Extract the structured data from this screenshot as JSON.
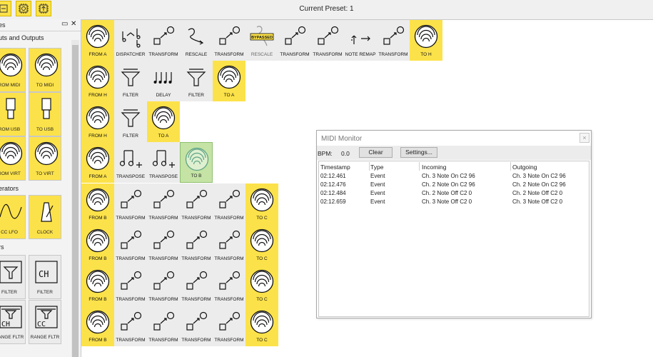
{
  "toolbar": {
    "current_preset": "Current Preset: 1"
  },
  "left_panel": {
    "title": "es",
    "sections": {
      "io": "uts and Outputs",
      "generators": "erators",
      "filters": "rs"
    },
    "items": [
      {
        "label": "ROM MIDI"
      },
      {
        "label": "TO MIDI"
      },
      {
        "label": "ROM USB"
      },
      {
        "label": "TO USB"
      },
      {
        "label": "ROM VIRT"
      },
      {
        "label": "TO VIRT"
      },
      {
        "label": "CC LFO"
      },
      {
        "label": "CLOCK"
      },
      {
        "label": "FILTER"
      },
      {
        "label": "FILTER"
      },
      {
        "label": "RANGE FLTR"
      },
      {
        "label": "RANGE FLTR"
      }
    ]
  },
  "canvas": {
    "rows": [
      [
        "FROM A",
        "DISPATCHER",
        "TRANSFORM",
        "RESCALE",
        "TRANSFORM",
        "RESCALE",
        "TRANSFORM",
        "TRANSFORM",
        "NOTE REMAP",
        "TRANSFORM",
        "TO H"
      ],
      [
        "FROM H",
        "FILTER",
        "DELAY",
        "FILTER",
        "TO A"
      ],
      [
        "FROM H",
        "FILTER",
        "TO A"
      ],
      [
        "FROM A",
        "TRANSPOSE",
        "TRANSPOSE",
        "TO B"
      ],
      [
        "FROM B",
        "TRANSFORM",
        "TRANSFORM",
        "TRANSFORM",
        "TRANSFORM",
        "TO C"
      ],
      [
        "FROM B",
        "TRANSFORM",
        "TRANSFORM",
        "TRANSFORM",
        "TRANSFORM",
        "TO C"
      ],
      [
        "FROM B",
        "TRANSFORM",
        "TRANSFORM",
        "TRANSFORM",
        "TRANSFORM",
        "TO C"
      ],
      [
        "FROM B",
        "TRANSFORM",
        "TRANSFORM",
        "TRANSFORM",
        "TRANSFORM",
        "TO C"
      ]
    ],
    "bypassed_badge": "BYPASSED"
  },
  "midi_monitor": {
    "title": "MIDI Monitor",
    "close": "×",
    "bpm_label": "BPM:",
    "bpm_value": "0.0",
    "clear": "Clear",
    "settings": "Settings...",
    "columns": [
      "Timestamp",
      "Type",
      "Incoming",
      "Outgoing"
    ],
    "rows": [
      [
        "02:12.461",
        "Event",
        "Ch. 3 Note On C2 96",
        "Ch. 3 Note On C2 96"
      ],
      [
        "02:12.476",
        "Event",
        "Ch. 2 Note On C2 96",
        "Ch. 2 Note On C2 96"
      ],
      [
        "02:12.484",
        "Event",
        "Ch. 2 Note Off C2 0",
        "Ch. 2 Note Off C2 0"
      ],
      [
        "02:12.659",
        "Event",
        "Ch. 3 Note Off C2 0",
        "Ch. 3 Note Off C2 0"
      ]
    ]
  },
  "colors": {
    "accent_yellow": "#fce24a",
    "tile_grey": "#ececec",
    "selected_green": "#c4e3a4"
  }
}
